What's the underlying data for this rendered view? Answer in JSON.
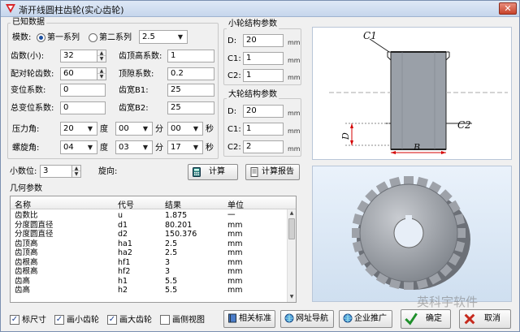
{
  "window": {
    "title": "渐开线圆柱齿轮(实心齿轮)",
    "close_glyph": "✕"
  },
  "known": {
    "group_title": "已知数据",
    "module_label": "模数:",
    "series1": "第一系列",
    "series2": "第二系列",
    "module_value": "2.5",
    "teeth_small_label": "齿数(小):",
    "teeth_small_value": "32",
    "addendum_coef_label": "齿顶高系数:",
    "addendum_coef_value": "1",
    "teeth_mate_label": "配对轮齿数:",
    "teeth_mate_value": "60",
    "clearance_label": "顶隙系数:",
    "clearance_value": "0.2",
    "shift_label": "变位系数:",
    "shift_value": "0",
    "width1_label": "齿宽B1:",
    "width1_value": "25",
    "total_shift_label": "总变位系数:",
    "total_shift_value": "0",
    "width2_label": "齿宽B2:",
    "width2_value": "25",
    "pressure_label": "压力角:",
    "pressure_deg": "20",
    "pressure_min": "00",
    "pressure_sec": "00",
    "helix_label": "螺旋角:",
    "helix_deg": "04",
    "helix_min": "03",
    "helix_sec": "17",
    "deg_unit": "度",
    "min_unit": "分",
    "sec_unit": "秒"
  },
  "decimals": {
    "label": "小数位:",
    "value": "3",
    "dir_label": "旋向:"
  },
  "buttons": {
    "calc": "计算",
    "report": "计算报告",
    "related": "相关标准",
    "nav": "网址导航",
    "promote": "企业推广",
    "ok": "确定",
    "cancel": "取消"
  },
  "small_wheel": {
    "title": "小轮结构参数",
    "d_label": "D:",
    "d_value": "20",
    "c1_label": "C1:",
    "c1_value": "1",
    "c2_label": "C2:",
    "c2_value": "1",
    "unit": "mm"
  },
  "large_wheel": {
    "title": "大轮结构参数",
    "d_label": "D:",
    "d_value": "20",
    "c1_label": "C1:",
    "c1_value": "1",
    "c2_label": "C2:",
    "c2_value": "2",
    "unit": "mm"
  },
  "geometry": {
    "title": "几何参数",
    "headers": [
      "名称",
      "代号",
      "结果",
      "单位"
    ],
    "rows": [
      [
        "齿数比",
        "u",
        "1.875",
        "一"
      ],
      [
        "分度圆直径",
        "d1",
        "80.201",
        "mm"
      ],
      [
        "分度圆直径",
        "d2",
        "150.376",
        "mm"
      ],
      [
        "齿顶高",
        "ha1",
        "2.5",
        "mm"
      ],
      [
        "齿顶高",
        "ha2",
        "2.5",
        "mm"
      ],
      [
        "齿根高",
        "hf1",
        "3",
        "mm"
      ],
      [
        "齿根高",
        "hf2",
        "3",
        "mm"
      ],
      [
        "齿高",
        "h1",
        "5.5",
        "mm"
      ],
      [
        "齿高",
        "h2",
        "5.5",
        "mm"
      ]
    ]
  },
  "checks": {
    "dim": "标尺寸",
    "small": "画小齿轮",
    "large": "画大齿轮",
    "side": "画侧视图"
  },
  "diagram": {
    "c1": "C1",
    "c2": "C2",
    "d": "D",
    "b": "B"
  },
  "watermark": "英科宇软件",
  "colors": {
    "title_bar": "#c6d6ec",
    "close": "#c7432b",
    "gear_body": "#9aa0a8",
    "dim_red": "#d40000"
  }
}
